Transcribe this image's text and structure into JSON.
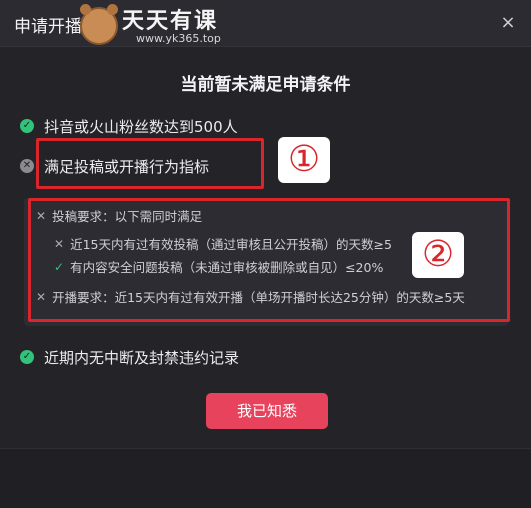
{
  "dialog": {
    "title": "申请开播权限",
    "close_glyph": "×"
  },
  "watermark": {
    "brand": "天天有课",
    "url": "www.yk365.top"
  },
  "heading": "当前暂未满足申请条件",
  "conditions": [
    {
      "text": "抖音或火山粉丝数达到500人",
      "status": "met"
    },
    {
      "text": "满足投稿或开播行为指标",
      "status": "unmet"
    },
    {
      "text": "近期内无中断及封禁违约记录",
      "status": "met"
    }
  ],
  "details": {
    "post_requirement": "投稿要求：以下需同时满足",
    "post_items": [
      {
        "text": "近15天内有过有效投稿（通过审核且公开投稿）的天数≥5",
        "status": "unmet"
      },
      {
        "text": "有内容安全问题投稿（未通过审核被删除或自见）≤20%",
        "status": "met"
      }
    ],
    "live_requirement": "开播要求：近15天内有过有效开播（单场开播时长达25分钟）的天数≥5天"
  },
  "annotations": {
    "label_1": "①",
    "label_2": "②"
  },
  "ack_button": "我已知悉",
  "colors": {
    "accent": "#e8435c",
    "success": "#31c27c",
    "annotation": "#d9262c"
  }
}
